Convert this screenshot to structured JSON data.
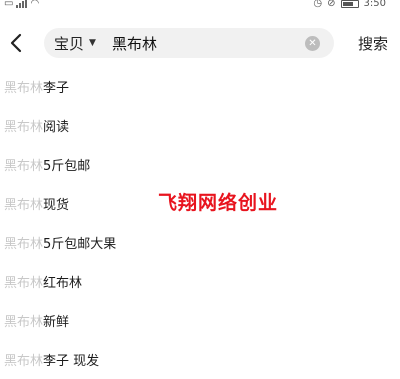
{
  "status": {
    "time": "3:50"
  },
  "search": {
    "back_label": "<",
    "scope": "宝贝",
    "query": "黑布林",
    "search_button": "搜索"
  },
  "suggestions": [
    {
      "prefix": "黑布林",
      "suffix": "李子"
    },
    {
      "prefix": "黑布林",
      "suffix": " 阅读"
    },
    {
      "prefix": "黑布林",
      "suffix": "5斤包邮"
    },
    {
      "prefix": "黑布林",
      "suffix": " 现货"
    },
    {
      "prefix": "黑布林",
      "suffix": "5斤包邮大果"
    },
    {
      "prefix": "黑布林",
      "suffix": "红布林"
    },
    {
      "prefix": "黑布林",
      "suffix": " 新鲜"
    },
    {
      "prefix": "黑布林",
      "suffix": "李子 现发"
    }
  ],
  "watermark": "飞翔网络创业",
  "colors": {
    "watermark": "#e8141e",
    "prefix": "#c8c8c8",
    "search_bg": "#f1f1f1"
  }
}
